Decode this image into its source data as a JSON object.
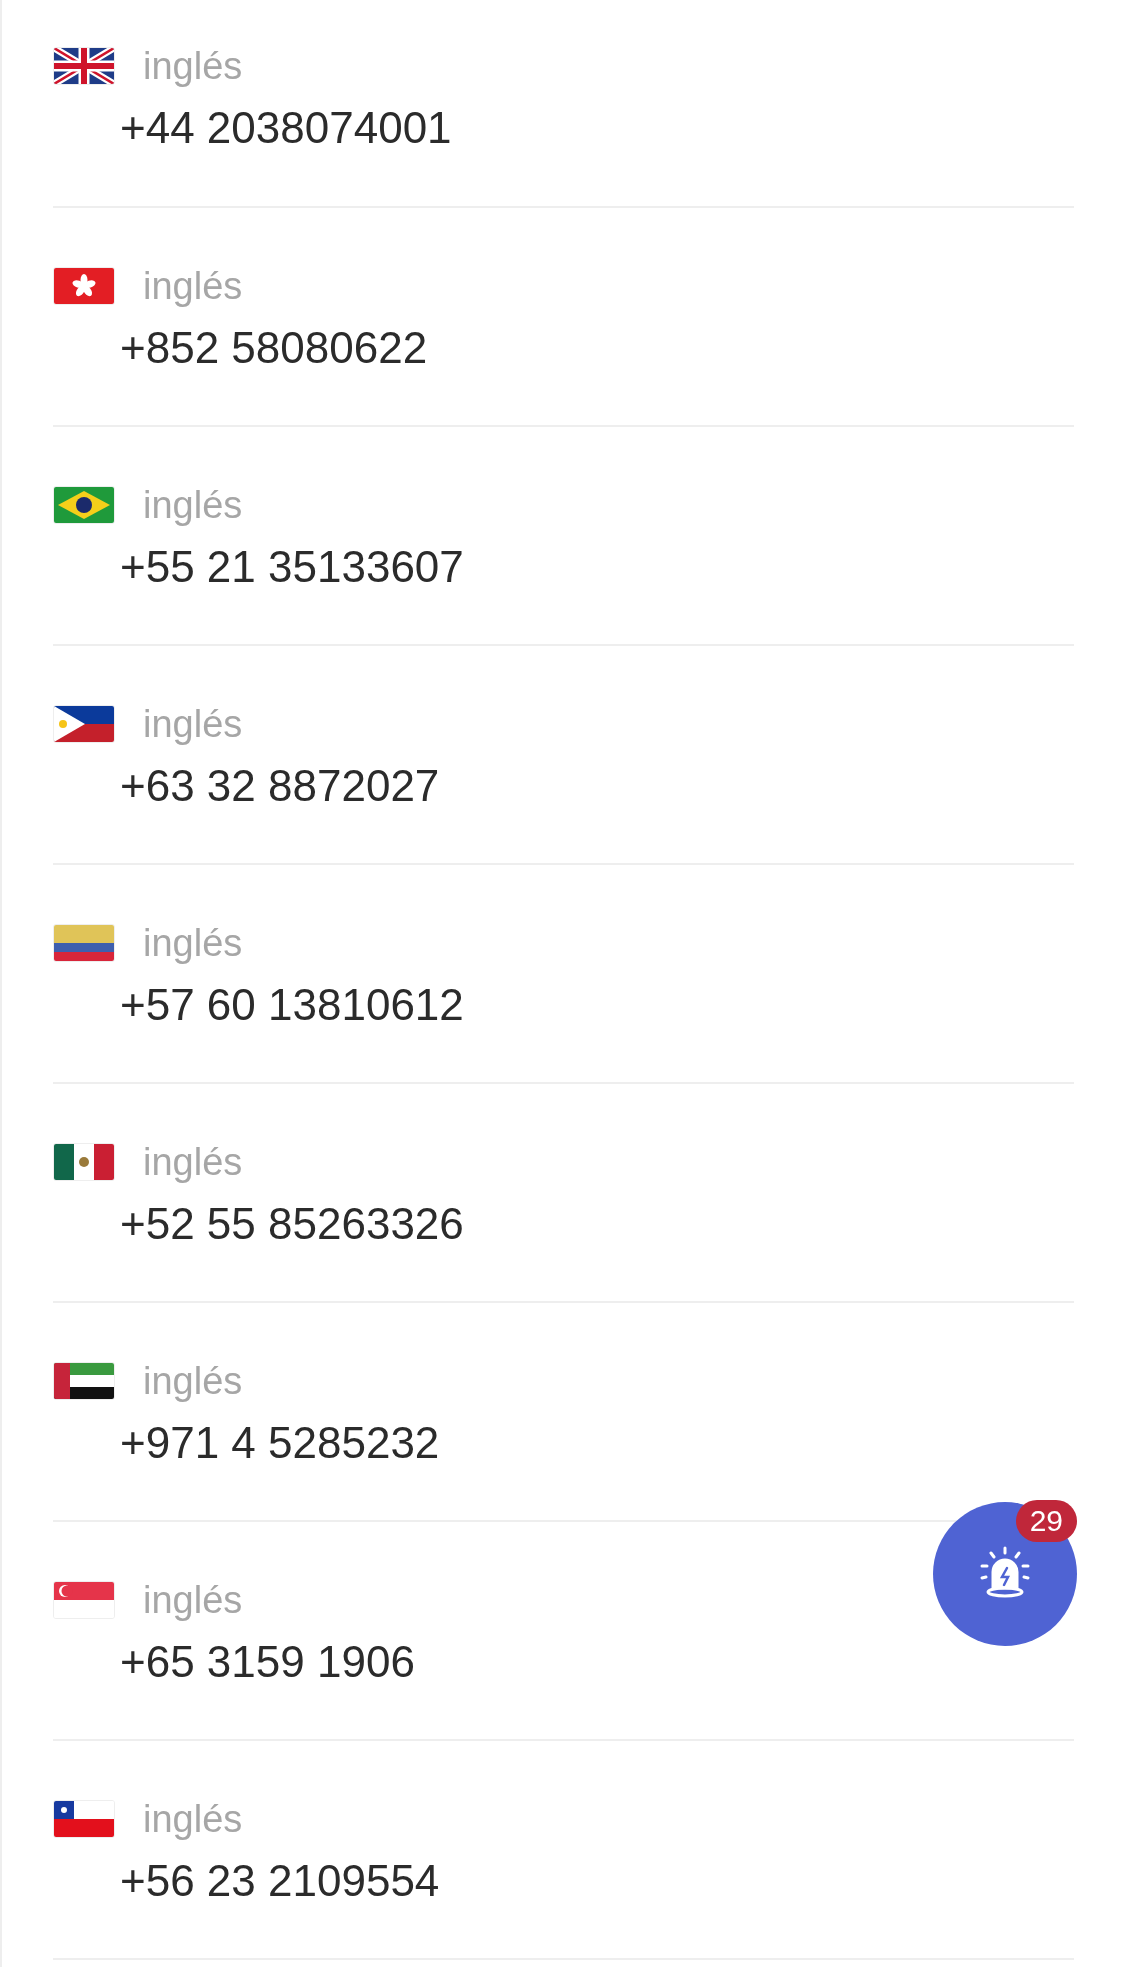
{
  "contacts": [
    {
      "kind": "uk",
      "language": "inglés",
      "phone": "+44 2038074001"
    },
    {
      "kind": "hk",
      "language": "inglés",
      "phone": "+852 58080622"
    },
    {
      "kind": "br",
      "language": "inglés",
      "phone": "+55 21 35133607"
    },
    {
      "kind": "ph",
      "language": "inglés",
      "phone": "+63 32 8872027"
    },
    {
      "kind": "co",
      "language": "inglés",
      "phone": "+57 60 13810612"
    },
    {
      "kind": "mx",
      "language": "inglés",
      "phone": "+52 55 85263326"
    },
    {
      "kind": "ae",
      "language": "inglés",
      "phone": "+971 4 5285232"
    },
    {
      "kind": "sg",
      "language": "inglés",
      "phone": "+65 3159 1906"
    },
    {
      "kind": "cl",
      "language": "inglés",
      "phone": "+56 23 2109554"
    }
  ],
  "alert_button": {
    "badge": "29"
  }
}
